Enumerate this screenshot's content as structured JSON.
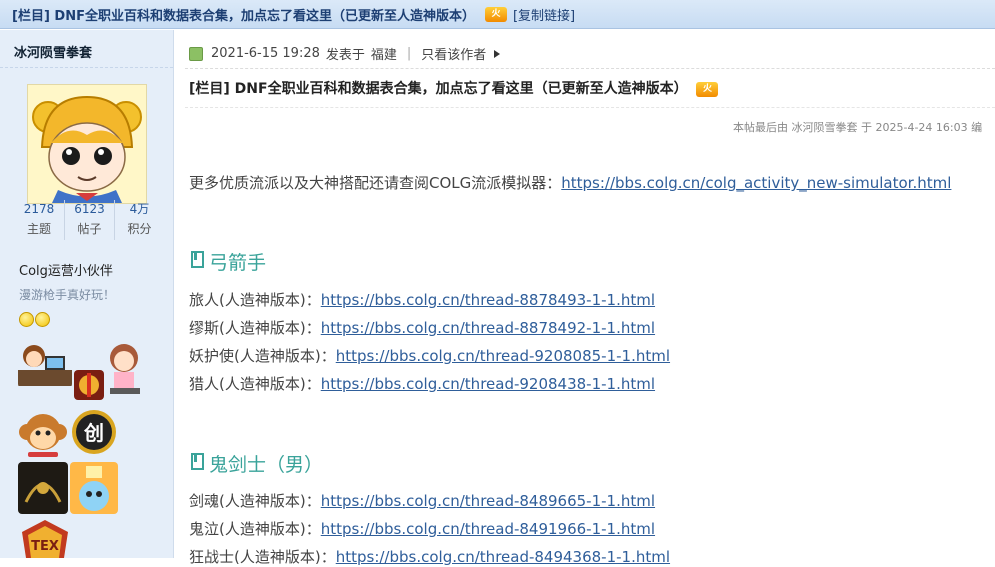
{
  "topbar": {
    "title": "[栏目] DNF全职业百科和数据表合集，加点忘了看这里（已更新至人造神版本）",
    "hot_badge": "火",
    "copy_link": "[复制链接]"
  },
  "user": {
    "name": "冰河陨雪拳套",
    "stats": [
      {
        "value": "2178",
        "label": "主题"
      },
      {
        "value": "6123",
        "label": "帖子"
      },
      {
        "value": "4万",
        "label": "积分"
      }
    ],
    "group": "Colg运营小伙伴",
    "signature": "漫游枪手真好玩！"
  },
  "post": {
    "date": "2021-6-15 19:28",
    "posted_text": "发表于",
    "location": "福建",
    "only_author": "只看该作者",
    "title": "[栏目] DNF全职业百科和数据表合集，加点忘了看这里（已更新至人造神版本）",
    "title_badge": "火",
    "edited": "本帖最后由 冰河陨雪拳套 于 2025-4-24 16:03 编",
    "intro_text": "更多优质流派以及大神搭配还请查阅COLG流派模拟器：",
    "intro_link": "https://bbs.colg.cn/colg_activity_new-simulator.html",
    "sections": [
      {
        "heading": "弓箭手",
        "items": [
          {
            "label": "旅人(人造神版本)：",
            "url": "https://bbs.colg.cn/thread-8878493-1-1.html"
          },
          {
            "label": "缪斯(人造神版本)：",
            "url": "https://bbs.colg.cn/thread-8878492-1-1.html"
          },
          {
            "label": "妖护使(人造神版本)：",
            "url": "https://bbs.colg.cn/thread-9208085-1-1.html"
          },
          {
            "label": "猎人(人造神版本)：",
            "url": "https://bbs.colg.cn/thread-9208438-1-1.html"
          }
        ]
      },
      {
        "heading": "鬼剑士（男）",
        "items": [
          {
            "label": "剑魂(人造神版本)：",
            "url": "https://bbs.colg.cn/thread-8489665-1-1.html"
          },
          {
            "label": "鬼泣(人造神版本)：",
            "url": "https://bbs.colg.cn/thread-8491966-1-1.html"
          },
          {
            "label": "狂战士(人造神版本)：",
            "url": "https://bbs.colg.cn/thread-8494368-1-1.html"
          }
        ]
      }
    ]
  },
  "colors": {
    "section_heading": "#3aa39a",
    "link": "#2f5e9a",
    "topbar": "#c7dcf3",
    "sidebar": "#e5eef9"
  }
}
